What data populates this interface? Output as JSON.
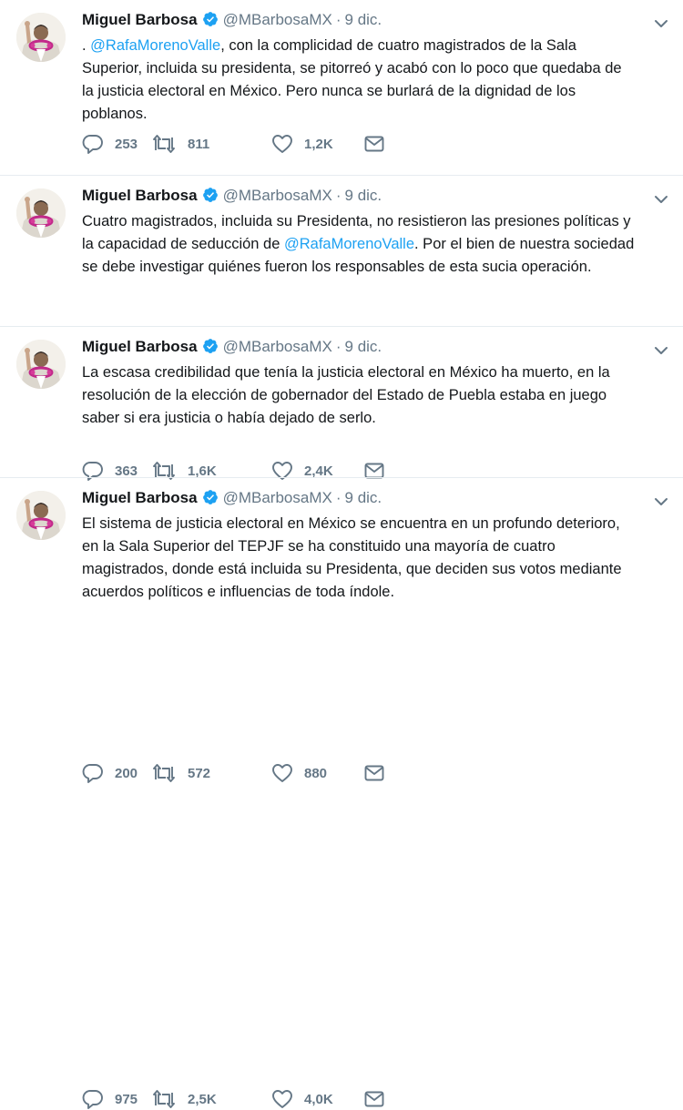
{
  "tweets": [
    {
      "name": "Miguel Barbosa",
      "handle": "@MBarbosaMX",
      "separator": "·",
      "date": "9 dic.",
      "lines": [
        [
          {
            "t": ". ",
            "m": false
          },
          {
            "t": "@RafaMorenoValle",
            "m": true
          },
          {
            "t": ", con la complicidad de cuatro magistrados de la Sala",
            "m": false
          }
        ],
        [
          {
            "t": "Superior, incluida su presidenta, se pitorreó y acabó con lo poco que quedaba de",
            "m": false
          }
        ],
        [
          {
            "t": "la justicia electoral en México. Pero nunca se burlará de la dignidad de los",
            "m": false
          }
        ],
        [
          {
            "t": "poblanos.",
            "m": false
          }
        ]
      ],
      "replies": "253",
      "retweets": "811",
      "likes": "1,2K"
    },
    {
      "name": "Miguel Barbosa",
      "handle": "@MBarbosaMX",
      "separator": "·",
      "date": "9 dic.",
      "lines": [
        [
          {
            "t": "Cuatro magistrados, incluida su Presidenta, no resistieron las presiones políticas y",
            "m": false
          }
        ],
        [
          {
            "t": "la capacidad de seducción de ",
            "m": false
          },
          {
            "t": "@RafaMorenoValle",
            "m": true
          },
          {
            "t": ". Por el bien de nuestra sociedad",
            "m": false
          }
        ],
        [
          {
            "t": "se debe investigar quiénes fueron los responsables de esta sucia operación.",
            "m": false
          }
        ]
      ],
      "replies": "363",
      "retweets": "1,6K",
      "likes": "2,4K"
    },
    {
      "name": "Miguel Barbosa",
      "handle": "@MBarbosaMX",
      "separator": "·",
      "date": "9 dic.",
      "lines": [
        [
          {
            "t": "La escasa credibilidad que tenía la justicia electoral en México ha muerto, en la",
            "m": false
          }
        ],
        [
          {
            "t": "resolución de la elección de gobernador del Estado de Puebla estaba en juego",
            "m": false
          }
        ],
        [
          {
            "t": "saber si era justicia o había dejado de serlo.",
            "m": false
          }
        ]
      ],
      "replies": "200",
      "retweets": "572",
      "likes": "880"
    },
    {
      "name": "Miguel Barbosa",
      "handle": "@MBarbosaMX",
      "separator": "·",
      "date": "9 dic.",
      "lines": [
        [
          {
            "t": "El sistema de justicia electoral en México se encuentra en un profundo deterioro,",
            "m": false
          }
        ],
        [
          {
            "t": "en la Sala Superior del TEPJF se ha constituido una mayoría de cuatro",
            "m": false
          }
        ],
        [
          {
            "t": "magistrados, donde está incluida su Presidenta, que deciden sus votos mediante",
            "m": false
          }
        ],
        [
          {
            "t": "acuerdos políticos e influencias de toda índole.",
            "m": false
          }
        ]
      ],
      "replies": "975",
      "retweets": "2,5K",
      "likes": "4,0K"
    }
  ],
  "colors": {
    "mention": "#1da1f2",
    "verified": "#1da1f2",
    "muted": "#657786",
    "text": "#14171a",
    "divider": "#e6ecf0"
  },
  "icons": {
    "reply": "reply-icon",
    "retweet": "retweet-icon",
    "like": "heart-icon",
    "message": "envelope-icon",
    "verified": "verified-badge-icon",
    "menu": "chevron-down-icon"
  }
}
